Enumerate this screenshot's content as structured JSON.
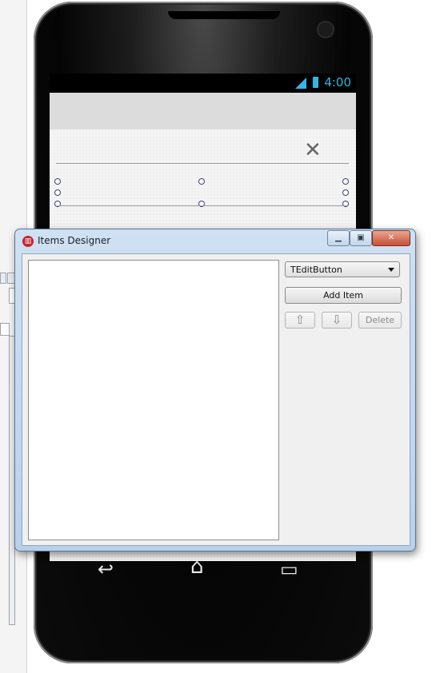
{
  "status_bar": {
    "time": "4:00"
  },
  "content": {
    "close_glyph": "✕"
  },
  "dialog": {
    "title": "Items Designer",
    "window_buttons": {
      "minimize": "▁",
      "maximize": "▣",
      "close": "✕"
    },
    "item_type_select": {
      "value": "TEditButton"
    },
    "add_item_label": "Add Item",
    "move_up_glyph": "⇧",
    "move_down_glyph": "⇩",
    "delete_label": "Delete"
  },
  "nav": {
    "back_glyph": "↩",
    "home_glyph": "⌂",
    "recents_glyph": "▭"
  },
  "colors": {
    "accent": "#33b5e5",
    "dialog_frame": "#b8d1ea",
    "close_button": "#c74f35"
  },
  "icons": [
    "signal-icon",
    "battery-icon",
    "app-icon",
    "minimize-icon",
    "maximize-icon",
    "close-icon",
    "arrow-up-icon",
    "arrow-down-icon",
    "back-icon",
    "home-icon",
    "recents-icon"
  ]
}
